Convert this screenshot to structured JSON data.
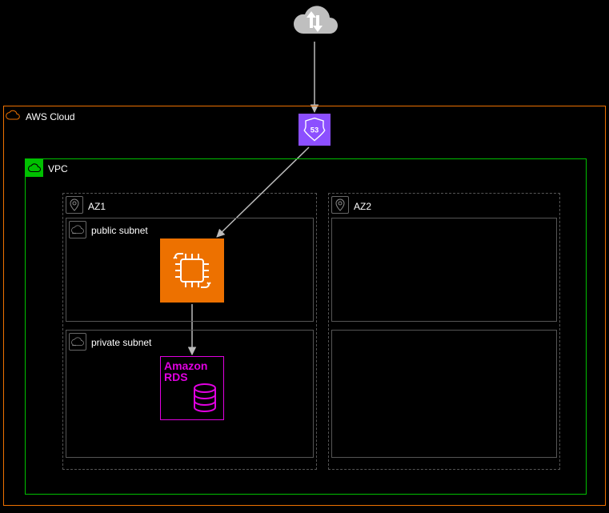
{
  "diagram": {
    "cloud_label": "AWS Cloud",
    "vpc_label": "VPC",
    "az1_label": "AZ1",
    "az2_label": "AZ2",
    "public_subnet_label": "public subnet",
    "private_subnet_label": "private subnet",
    "route53_badge": "53",
    "rds_line1": "Amazon",
    "rds_line2": "RDS"
  },
  "icons": {
    "internet": "internet-gateway-cloud",
    "aws_cloud": "aws-cloud-icon",
    "vpc": "vpc-icon",
    "az": "pin-icon",
    "subnet": "subnet-icon",
    "route53": "route53-shield-icon",
    "ec2": "ec2-chip-icon",
    "rds": "rds-database-icon"
  },
  "colors": {
    "aws_orange": "#ED7100",
    "vpc_green": "#00C000",
    "route53_purple": "#8C4FFF",
    "rds_magenta": "#E000E0",
    "dashed_grey": "#555555"
  },
  "connections": [
    {
      "from": "internet",
      "to": "route53"
    },
    {
      "from": "route53",
      "to": "ec2"
    },
    {
      "from": "ec2",
      "to": "rds"
    }
  ]
}
